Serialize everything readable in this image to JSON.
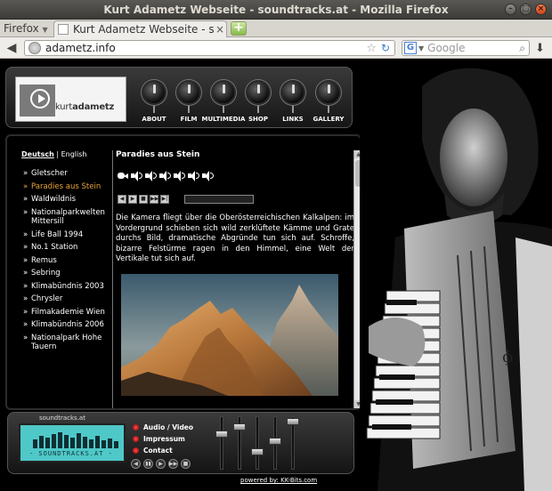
{
  "window": {
    "title": "Kurt Adametz Webseite - soundtracks.at - Mozilla Firefox",
    "buttons": {
      "minimize": "–",
      "maximize": "□",
      "close": "×"
    }
  },
  "browser": {
    "menu_label": "Firefox",
    "tab_title": "Kurt Adametz Webseite - soun...",
    "tab_close": "×",
    "new_tab": "+",
    "url": "adametz.info",
    "search_placeholder": "Google",
    "search_engine": "G"
  },
  "header": {
    "logo_prefix": "kurt",
    "logo_suffix": "adametz",
    "nav": [
      {
        "label": "ABOUT"
      },
      {
        "label": "FILM"
      },
      {
        "label": "MULTIMEDIA"
      },
      {
        "label": "SHOP"
      },
      {
        "label": "LINKS"
      },
      {
        "label": "GALLERY"
      }
    ]
  },
  "lang": {
    "de": "Deutsch",
    "sep": "|",
    "en": "English"
  },
  "sidebar": {
    "bullet": "»",
    "items": [
      {
        "label": "Gletscher"
      },
      {
        "label": "Paradies aus Stein"
      },
      {
        "label": "Waldwildnis"
      },
      {
        "label": "Nationalparkwelten Mittersill"
      },
      {
        "label": "Life Ball 1994"
      },
      {
        "label": "No.1 Station"
      },
      {
        "label": "Remus"
      },
      {
        "label": "Sebring"
      },
      {
        "label": "Klimabündnis 2003"
      },
      {
        "label": "Chrysler"
      },
      {
        "label": "Filmakademie Wien"
      },
      {
        "label": "Klimabündnis 2006"
      },
      {
        "label": "Nationalpark Hohe Tauern"
      }
    ],
    "active_index": 1
  },
  "content": {
    "title": "Paradies aus Stein",
    "description": "Die Kamera fliegt über die Oberösterreichischen Kalkalpen: im Vordergrund schieben sich wild zerklüftete Kämme und Grate durchs Bild, dramatische Abgründe tun sich auf. Schroffe, bizarre Felstürme ragen in den Himmel, eine Welt der Vertikale tut sich auf.",
    "player_controls": [
      "◀",
      "▶",
      "■",
      "▶▶",
      "▶|"
    ]
  },
  "player": {
    "label": "soundtracks.at",
    "lcd_text": "- SOUNDTRACKS.AT -",
    "links": [
      {
        "label": "Audio / Video"
      },
      {
        "label": "Impressum"
      },
      {
        "label": "Contact"
      }
    ],
    "buttons": [
      "◀",
      "▮▮",
      "▶",
      "▶▶",
      "■"
    ]
  },
  "footer": {
    "powered": "powered by: KK-Bits.com"
  }
}
